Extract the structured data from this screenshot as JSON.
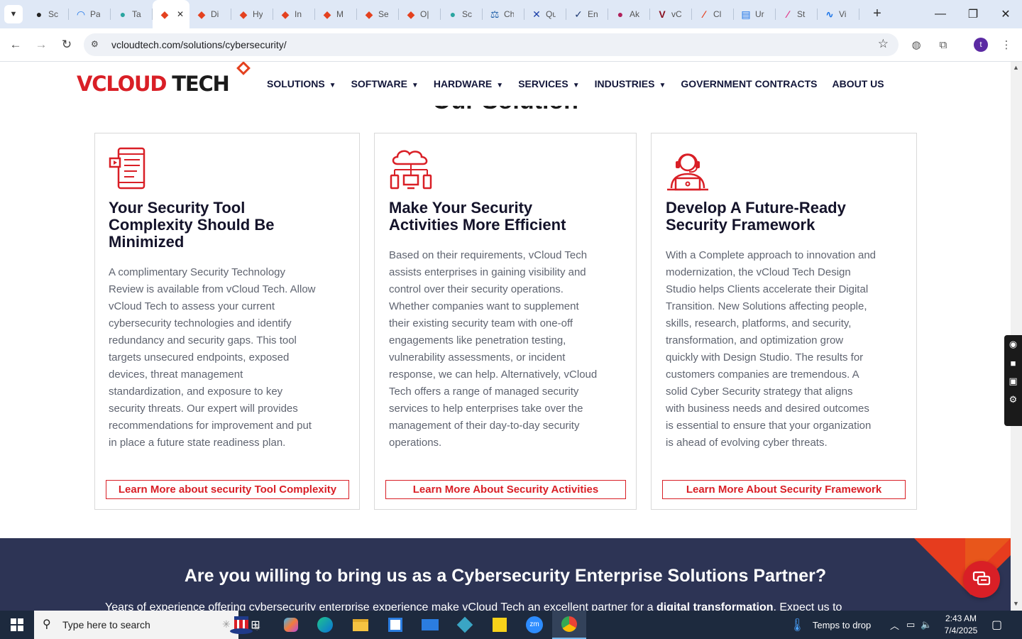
{
  "browser": {
    "tabs": [
      {
        "label": "Sc",
        "color": "#222222",
        "glyph": "●"
      },
      {
        "label": "Pa",
        "color": "#1a73e8",
        "glyph": "◠"
      },
      {
        "label": "Ta",
        "color": "#2aa5a0",
        "glyph": "●"
      },
      {
        "label": "",
        "color": "#e4411f",
        "glyph": "◆",
        "active": true
      },
      {
        "label": "Di",
        "color": "#e4411f",
        "glyph": "◆"
      },
      {
        "label": "Hy",
        "color": "#e4411f",
        "glyph": "◆"
      },
      {
        "label": "In",
        "color": "#e4411f",
        "glyph": "◆"
      },
      {
        "label": "M",
        "color": "#e4411f",
        "glyph": "◆"
      },
      {
        "label": "Se",
        "color": "#e4411f",
        "glyph": "◆"
      },
      {
        "label": "O|",
        "color": "#e4411f",
        "glyph": "◆"
      },
      {
        "label": "Sc",
        "color": "#2aa5a0",
        "glyph": "●"
      },
      {
        "label": "Ch",
        "color": "#1f5fa8",
        "glyph": "⚖"
      },
      {
        "label": "Qu",
        "color": "#1a3ea8",
        "glyph": "✕"
      },
      {
        "label": "En",
        "color": "#1f3a73",
        "glyph": "✓"
      },
      {
        "label": "Ak",
        "color": "#b0205a",
        "glyph": "●"
      },
      {
        "label": "vC",
        "color": "#8a1020",
        "glyph": "V"
      },
      {
        "label": "Cl",
        "color": "#e4411f",
        "glyph": "∕"
      },
      {
        "label": "Ur",
        "color": "#1a73e8",
        "glyph": "▤"
      },
      {
        "label": "St",
        "color": "#e03a8a",
        "glyph": "∕"
      },
      {
        "label": "Vi",
        "color": "#1a73e8",
        "glyph": "∿"
      }
    ],
    "url": "vcloudtech.com/solutions/cybersecurity/",
    "profile_initial": "t"
  },
  "site": {
    "logo": {
      "v": "V",
      "cloud": "CLOUD",
      "tech": "TECH"
    },
    "nav": [
      {
        "label": "SOLUTIONS",
        "dropdown": true
      },
      {
        "label": "SOFTWARE",
        "dropdown": true
      },
      {
        "label": "HARDWARE",
        "dropdown": true
      },
      {
        "label": "SERVICES",
        "dropdown": true
      },
      {
        "label": "INDUSTRIES",
        "dropdown": true
      },
      {
        "label": "GOVERNMENT CONTRACTS",
        "dropdown": false
      },
      {
        "label": "ABOUT US",
        "dropdown": false
      }
    ],
    "section_heading": "Our Solution",
    "cards": [
      {
        "icon": "tablet-document-icon",
        "title_lines": [
          "Your Security Tool",
          "Complexity Should Be",
          "Minimized"
        ],
        "body_lines": [
          "A complimentary Security Technology",
          "Review is available from vCloud Tech. Allow",
          "vCloud Tech to assess your current",
          "cybersecurity technologies and identify",
          "redundancy and security gaps. This tool",
          "targets unsecured endpoints, exposed",
          "devices, threat management",
          "standardization, and exposure to key",
          "security threats. Our expert will provides",
          "recommendations for improvement and put",
          "in place a future state readiness plan."
        ],
        "cta": "Learn More about security Tool Complexity"
      },
      {
        "icon": "cloud-network-icon",
        "title_lines": [
          "Make Your Security",
          "Activities More Efficient"
        ],
        "body_lines": [
          "Based on their requirements, vCloud Tech",
          "assists enterprises in gaining visibility and",
          "control over their security operations.",
          "Whether companies want to supplement",
          "their existing security team with one-off",
          "engagements like penetration testing,",
          "vulnerability assessments, or incident",
          "response, we can help. Alternatively, vCloud",
          "Tech offers a range of managed security",
          "services to help enterprises take over the",
          "management of their day-to-day security",
          "operations."
        ],
        "cta": "Learn More About Security Activities"
      },
      {
        "icon": "support-agent-icon",
        "title_lines": [
          "Develop A Future-Ready",
          "Security Framework"
        ],
        "body_lines": [
          "With a Complete approach to innovation and",
          "modernization, the vCloud Tech Design",
          "Studio helps Clients accelerate their Digital",
          "Transition. New Solutions affecting people,",
          "skills, research, platforms, and security,",
          "transformation, and optimization grow",
          "quickly with Design Studio. The results for",
          "customers companies are tremendous. A",
          "solid Cyber Security strategy that aligns",
          "with business needs and desired outcomes",
          "is essential to ensure that your organization",
          "is ahead of evolving cyber threats."
        ],
        "cta": "Learn More About Security Framework"
      }
    ],
    "partner": {
      "heading": "Are you willing to bring us as a Cybersecurity Enterprise Solutions Partner?",
      "sub_start": "Years of experience offering cybersecurity enterprise experience make vCloud Tech an excellent partner for a ",
      "sub_bold": "digital transformation",
      "sub_end": ". Expect us to"
    }
  },
  "taskbar": {
    "search_placeholder": "Type here to search",
    "weather": "Temps to drop",
    "time": "2:43 AM",
    "date": "7/4/2025"
  },
  "colors": {
    "brand_red": "#d91f26",
    "navy": "#2d3455",
    "orange": "#e4411f"
  }
}
